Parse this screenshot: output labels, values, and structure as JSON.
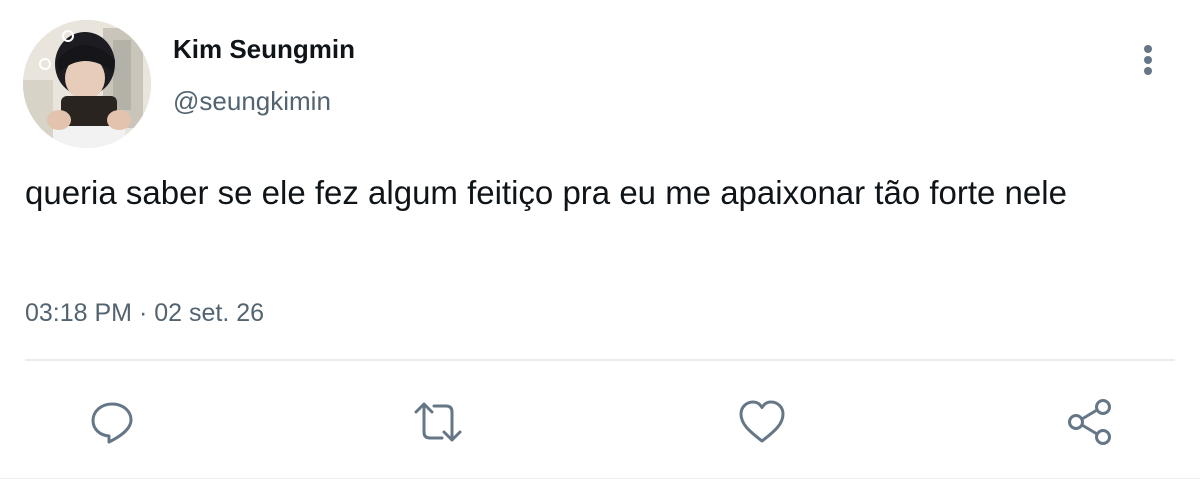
{
  "author": {
    "display_name": "Kim Seungmin",
    "handle": "@seungkimin",
    "avatar_icon": "profile-photo"
  },
  "tweet": {
    "text": "queria saber se ele fez algum feitiço pra eu me apaixonar tão forte nele",
    "time": "03:18 PM",
    "separator": "·",
    "date": "02 set. 26"
  },
  "actions": {
    "reply_icon": "speech-bubble-icon",
    "retweet_icon": "retweet-icon",
    "like_icon": "heart-icon",
    "share_icon": "share-icon",
    "more_icon": "vertical-dots-icon"
  },
  "colors": {
    "text_primary": "#0f1419",
    "text_secondary": "#536471",
    "divider": "#e6ecf0"
  }
}
